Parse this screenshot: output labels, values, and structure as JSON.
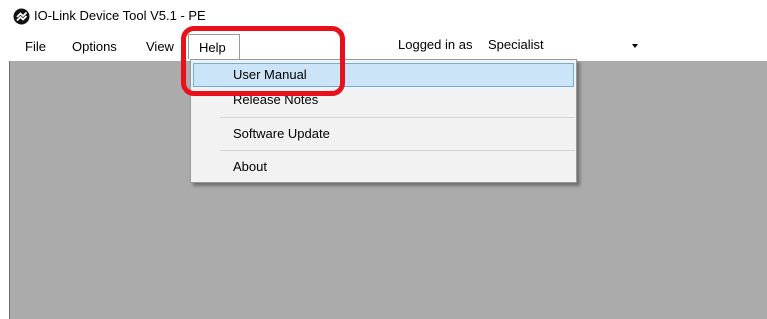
{
  "window": {
    "title": "IO-Link Device Tool V5.1 - PE",
    "icon": "device-tool-app-icon"
  },
  "menubar": {
    "items": [
      {
        "label": "File"
      },
      {
        "label": "Options"
      },
      {
        "label": "View"
      },
      {
        "label": "Help"
      }
    ],
    "logged_in_label": "Logged in as",
    "role_value": "Specialist"
  },
  "help_menu": {
    "items": [
      {
        "label": "User Manual"
      },
      {
        "label": "Release Notes"
      },
      {
        "label": "Software Update"
      },
      {
        "label": "About"
      }
    ],
    "highlighted": "User Manual"
  },
  "colors": {
    "workspace": "#ababab",
    "menu_highlight": "#cce4f7",
    "menu_highlight_border": "#6aaee6",
    "annotation": "#e8101a"
  }
}
